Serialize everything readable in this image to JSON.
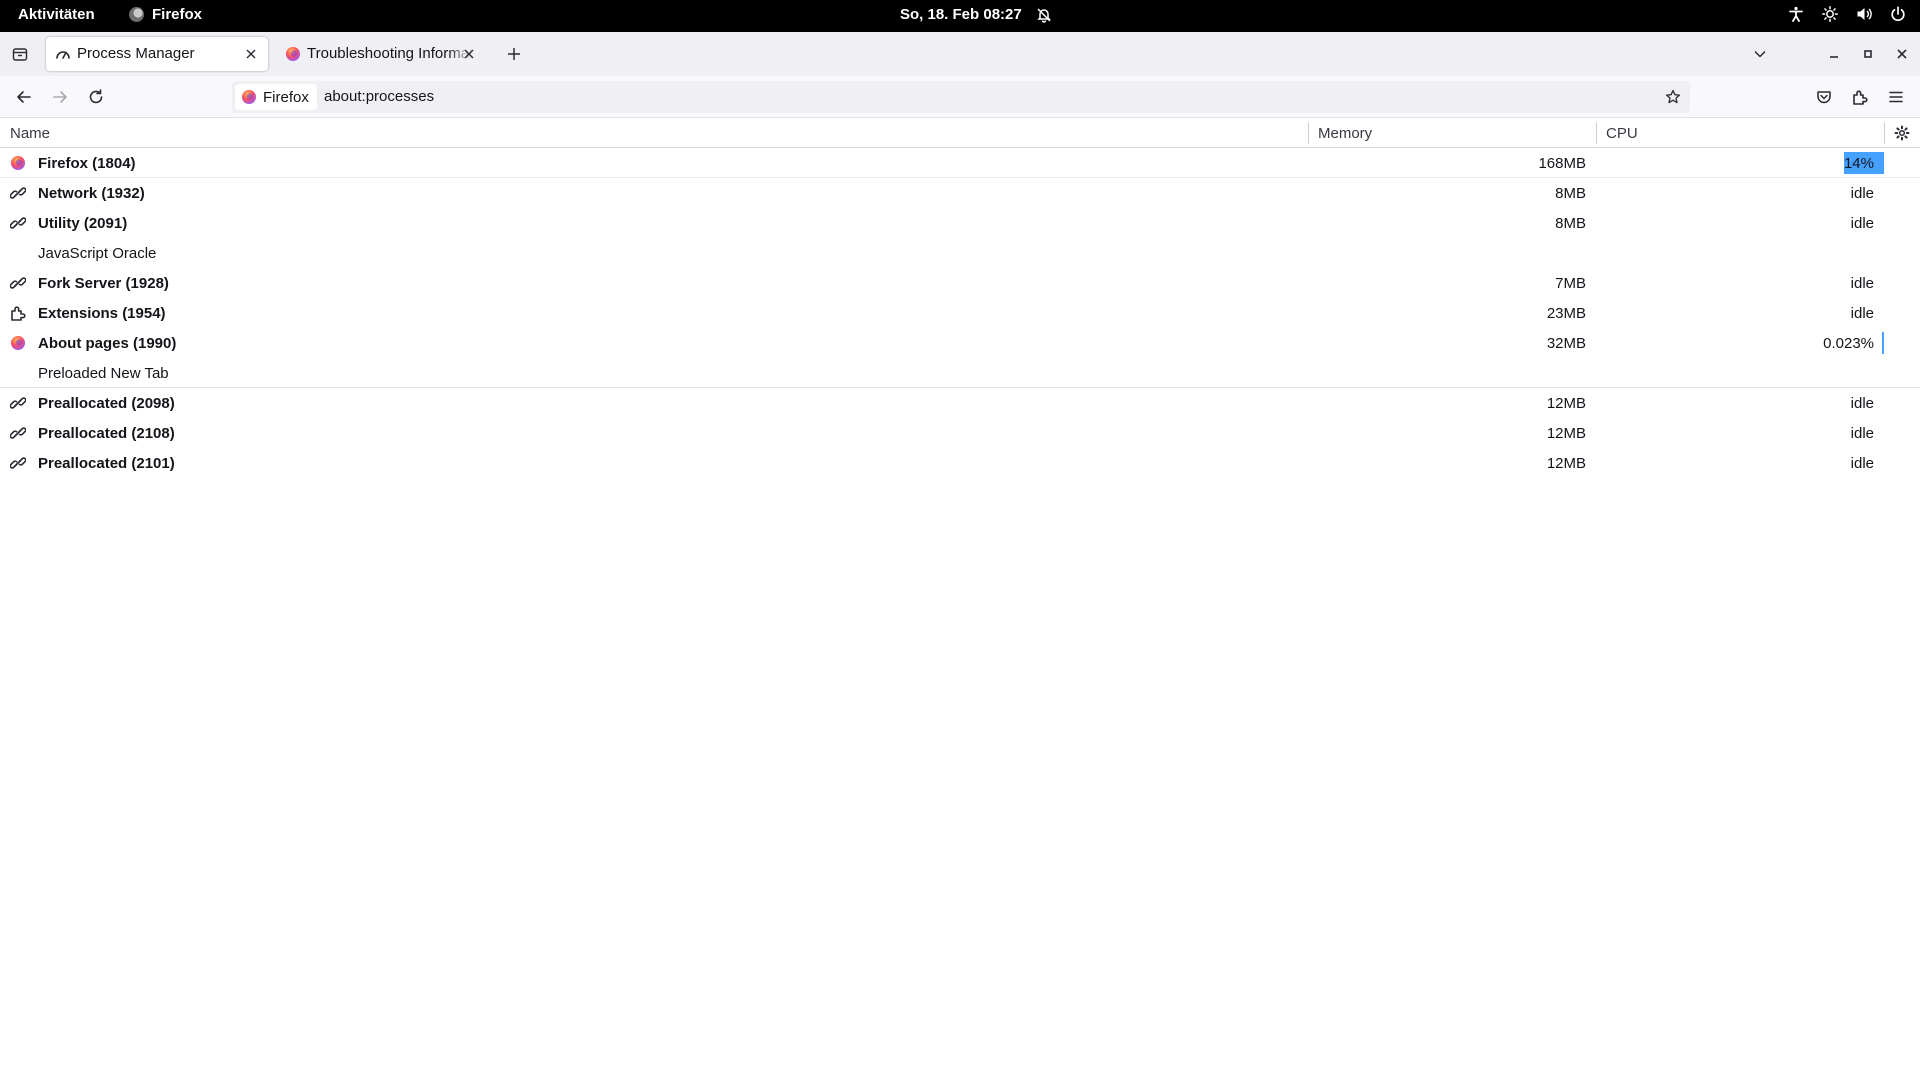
{
  "topbar": {
    "activities": "Aktivitäten",
    "app_name": "Firefox",
    "clock": "So, 18. Feb  08:27",
    "icons": [
      "bell-off-icon",
      "accessibility-icon",
      "brightness-icon",
      "volume-icon",
      "power-icon"
    ]
  },
  "tabs": [
    {
      "title": "Process Manager",
      "icon": "processes-icon",
      "active": true
    },
    {
      "title": "Troubleshooting Information",
      "icon": "firefox-icon",
      "active": false
    }
  ],
  "urlbar": {
    "identity_label": "Firefox",
    "url": "about:processes"
  },
  "table": {
    "headers": {
      "name": "Name",
      "memory": "Memory",
      "cpu": "CPU"
    },
    "rows": [
      {
        "name": "Firefox (1804)",
        "memory": "168MB",
        "cpu": "14%",
        "icon": "firefox-icon",
        "kind": "proc",
        "cpu_fraction": 0.14
      },
      {
        "name": "Network (1932)",
        "memory": "8MB",
        "cpu": "idle",
        "icon": "connection-icon",
        "kind": "proc"
      },
      {
        "name": "Utility (2091)",
        "memory": "8MB",
        "cpu": "idle",
        "icon": "connection-icon",
        "kind": "proc"
      },
      {
        "name": "JavaScript Oracle",
        "memory": "",
        "cpu": "",
        "icon": "",
        "kind": "sub"
      },
      {
        "name": "Fork Server (1928)",
        "memory": "7MB",
        "cpu": "idle",
        "icon": "connection-icon",
        "kind": "proc"
      },
      {
        "name": "Extensions (1954)",
        "memory": "23MB",
        "cpu": "idle",
        "icon": "extension-icon",
        "kind": "proc"
      },
      {
        "name": "About pages (1990)",
        "memory": "32MB",
        "cpu": "0.023%",
        "icon": "firefox-icon",
        "kind": "proc",
        "cpu_fraction": 0.00023
      },
      {
        "name": "Preloaded New Tab",
        "memory": "",
        "cpu": "",
        "icon": "",
        "kind": "sub"
      },
      {
        "name": "Preallocated (2098)",
        "memory": "12MB",
        "cpu": "idle",
        "icon": "connection-icon",
        "kind": "proc"
      },
      {
        "name": "Preallocated (2108)",
        "memory": "12MB",
        "cpu": "idle",
        "icon": "connection-icon",
        "kind": "proc"
      },
      {
        "name": "Preallocated (2101)",
        "memory": "12MB",
        "cpu": "idle",
        "icon": "connection-icon",
        "kind": "proc"
      }
    ]
  },
  "colors": {
    "cpu_bar": "#45a1ff",
    "tabstrip_bg": "#f0f0f4",
    "topbar_bg": "#000000"
  }
}
